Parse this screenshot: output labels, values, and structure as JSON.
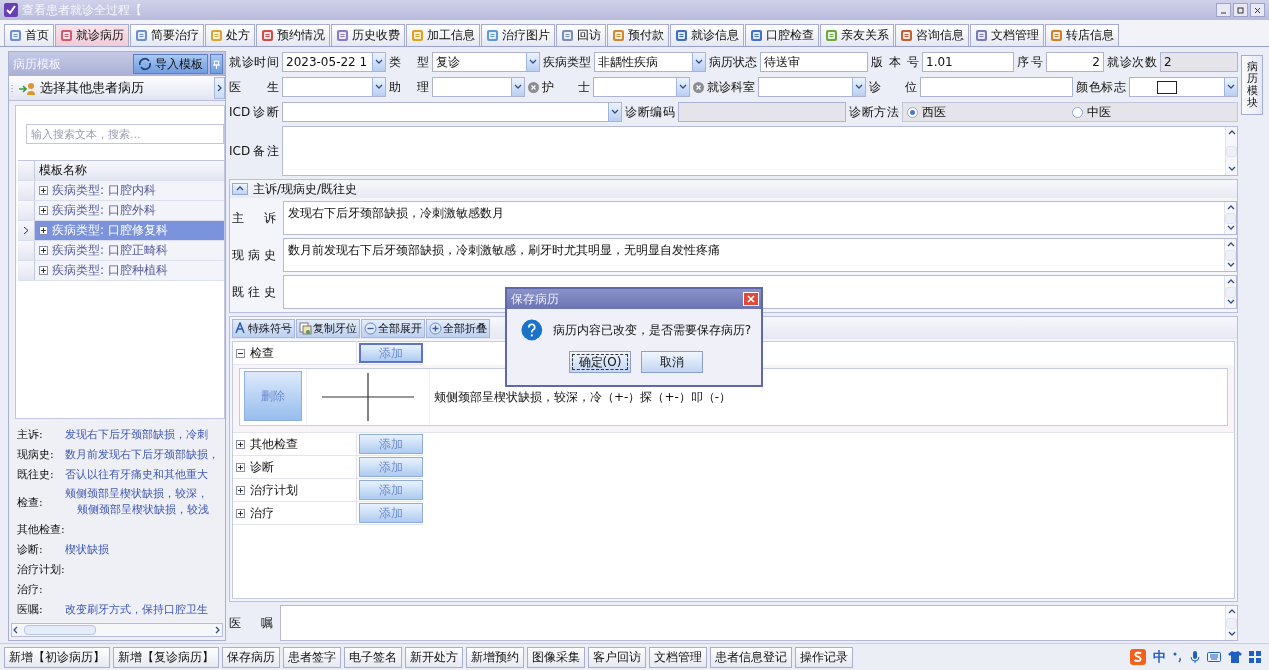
{
  "window": {
    "title": "查看患者就诊全过程【"
  },
  "tabs": [
    {
      "label": "首页",
      "selected": false
    },
    {
      "label": "就诊病历",
      "selected": true
    },
    {
      "label": "简要治疗",
      "selected": false
    },
    {
      "label": "处方",
      "selected": false
    },
    {
      "label": "预约情况",
      "selected": false
    },
    {
      "label": "历史收费",
      "selected": false
    },
    {
      "label": "加工信息",
      "selected": false
    },
    {
      "label": "治疗图片",
      "selected": false
    },
    {
      "label": "回访",
      "selected": false
    },
    {
      "label": "预付款",
      "selected": false
    },
    {
      "label": "就诊信息",
      "selected": false
    },
    {
      "label": "口腔检查",
      "selected": false
    },
    {
      "label": "亲友关系",
      "selected": false
    },
    {
      "label": "咨询信息",
      "selected": false
    },
    {
      "label": "文档管理",
      "selected": false
    },
    {
      "label": "转店信息",
      "selected": false
    }
  ],
  "template_panel": {
    "title": "病历模板",
    "import_button": "导入模板",
    "other_patient": "选择其他患者病历",
    "search": {
      "placeholder": "输入搜索文本，搜索..."
    },
    "column": "模板名称",
    "rows": [
      {
        "label": "疾病类型: 口腔内科",
        "selected": false
      },
      {
        "label": "疾病类型: 口腔外科",
        "selected": false
      },
      {
        "label": "疾病类型: 口腔修复科",
        "selected": true
      },
      {
        "label": "疾病类型: 口腔正畸科",
        "selected": false
      },
      {
        "label": "疾病类型: 口腔种植科",
        "selected": false
      }
    ],
    "summary": [
      {
        "label": "主诉:",
        "lines": [
          "发现右下后牙颈部缺损，冷刺"
        ]
      },
      {
        "label": "现病史:",
        "lines": [
          "数月前发现右下后牙颈部缺损，"
        ]
      },
      {
        "label": "既往史:",
        "lines": [
          "否认以往有牙痛史和其他重大"
        ]
      },
      {
        "label": "检查:",
        "lines": [
          "颊侧颈部呈楔状缺损，较深，",
          "颊侧颈部呈楔状缺损，较浅"
        ]
      },
      {
        "label": "其他检查:"
      },
      {
        "label": "诊断:",
        "lines": [
          "楔状缺损"
        ]
      },
      {
        "label": "治疗计划:"
      },
      {
        "label": "治疗:"
      },
      {
        "label": "医嘱:",
        "lines": [
          "改变刷牙方式，保持口腔卫生"
        ]
      }
    ]
  },
  "form": {
    "lines": [
      {
        "fields": [
          {
            "label": "就诊时间",
            "kind": "select",
            "value": "2023-05-22 1"
          },
          {
            "label": "类 型",
            "kind": "select",
            "value": "复诊"
          },
          {
            "label": "疾病类型",
            "kind": "select",
            "value": "非龋性疾病"
          },
          {
            "label": "病历状态",
            "kind": "text",
            "value": "待送审"
          },
          {
            "label": "版 本 号",
            "kind": "text",
            "value": "1.01"
          },
          {
            "label": "序号",
            "kind": "number",
            "value": "2"
          },
          {
            "label": "就诊次数",
            "kind": "readonly",
            "value": "2"
          }
        ]
      },
      {
        "fields": [
          {
            "label": "医 生",
            "kind": "select"
          },
          {
            "label": "助 理",
            "kind": "select_clear"
          },
          {
            "label": "护 士",
            "kind": "select_clear"
          },
          {
            "label": "就诊科室",
            "kind": "select"
          },
          {
            "label": "诊 位",
            "kind": "text"
          },
          {
            "label": "颜色标志",
            "kind": "color"
          }
        ]
      },
      {
        "fields": [
          {
            "label": "ICD诊断",
            "kind": "select"
          },
          {
            "label": "诊断编码",
            "kind": "readonly"
          },
          {
            "label": "诊断方法",
            "kind": "radio",
            "options": [
              {
                "label": "西医",
                "selected": true
              },
              {
                "label": "中医",
                "selected": false
              }
            ]
          }
        ]
      },
      {
        "fields": [
          {
            "label": "ICD备注",
            "kind": "textarea"
          }
        ]
      }
    ]
  },
  "history": {
    "title": "主诉/现病史/既往史",
    "expanded": true,
    "fields": [
      {
        "label": "主 诉",
        "value": "发现右下后牙颈部缺损，冷刺激敏感数月"
      },
      {
        "label": "现 病 史",
        "value": "数月前发现右下后牙颈部缺损，冷刺激敏感，刷牙时尤其明显，无明显自发性疼痛"
      },
      {
        "label": "既 往 史"
      }
    ]
  },
  "exam_toolbar": [
    "特殊符号",
    "复制牙位",
    "全部展开",
    "全部折叠"
  ],
  "exam_items": [
    {
      "label": "检查",
      "button": "添加",
      "expanded": true,
      "focused": true,
      "entries": [
        {
          "button": "删除",
          "text": "颊侧颈部呈楔状缺损，较深，冷（+-）探（+-）叩（-）"
        }
      ]
    },
    {
      "label": "其他检查",
      "button": "添加",
      "expanded": false,
      "focused": false
    },
    {
      "label": "诊断",
      "button": "添加",
      "expanded": false,
      "focused": false
    },
    {
      "label": "治疗计划",
      "button": "添加",
      "expanded": false,
      "focused": false
    },
    {
      "label": "治疗",
      "button": "添加",
      "expanded": false,
      "focused": false
    }
  ],
  "advice": {
    "label": "医 嘱"
  },
  "side_tab": "病历模块",
  "bottom_buttons": [
    "新增【初诊病历】",
    "新增【复诊病历】",
    "保存病历",
    "患者签字",
    "电子签名",
    "新开处方",
    "新增预约",
    "图像采集",
    "客户回访",
    "文档管理",
    "患者信息登记",
    "操作记录"
  ],
  "tray": {
    "ime": "中"
  },
  "dialog": {
    "title": "保存病历",
    "message": "病历内容已改变，是否需要保存病历?",
    "buttons": [
      {
        "label": "确定(O)",
        "focused": true
      },
      {
        "label": "取消",
        "focused": false
      }
    ]
  }
}
